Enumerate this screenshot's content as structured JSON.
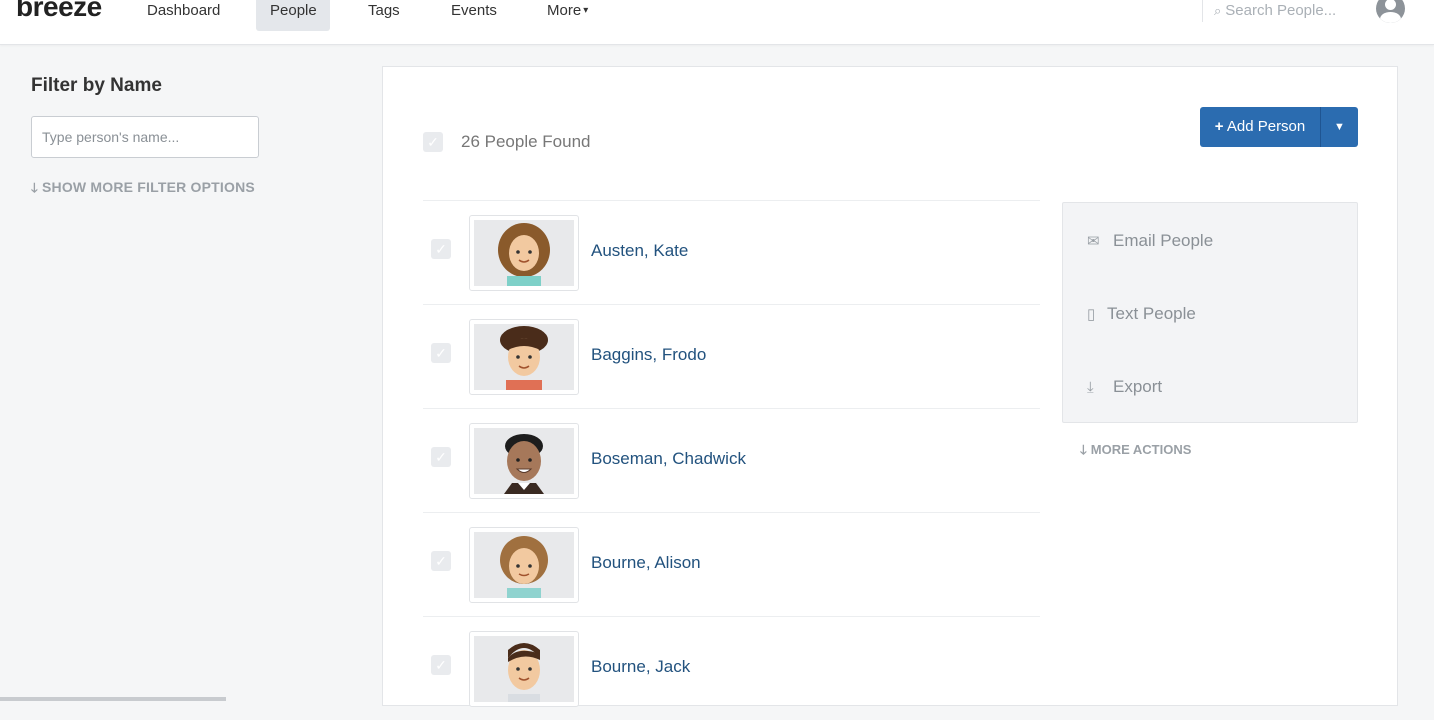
{
  "app": {
    "logo": "breeze"
  },
  "nav": {
    "items": [
      {
        "label": "Dashboard"
      },
      {
        "label": "People"
      },
      {
        "label": "Tags"
      },
      {
        "label": "Events"
      },
      {
        "label": "More"
      }
    ],
    "search_placeholder": "Search People..."
  },
  "sidebar": {
    "title": "Filter by Name",
    "input_placeholder": "Type person's name...",
    "more_filters": "SHOW MORE FILTER OPTIONS"
  },
  "main": {
    "found_text": "26 People Found",
    "add_button": "Add Person",
    "people": [
      {
        "name": "Austen, Kate"
      },
      {
        "name": "Baggins, Frodo"
      },
      {
        "name": "Boseman, Chadwick"
      },
      {
        "name": "Bourne, Alison"
      },
      {
        "name": "Bourne, Jack"
      }
    ],
    "actions": [
      {
        "label": "Email People",
        "icon": "envelope-icon"
      },
      {
        "label": "Text People",
        "icon": "mobile-icon"
      },
      {
        "label": "Export",
        "icon": "download-icon"
      }
    ],
    "more_actions": "MORE ACTIONS"
  },
  "colors": {
    "primary": "#2b6cb0",
    "link": "#22527e",
    "muted": "#9aa0a6"
  }
}
